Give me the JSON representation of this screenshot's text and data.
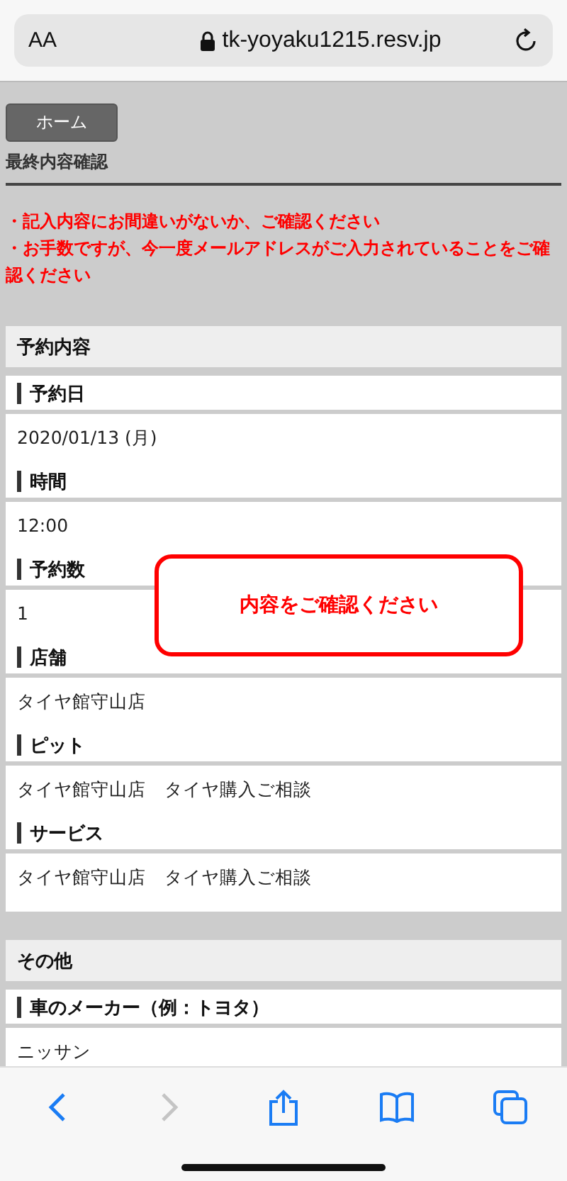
{
  "address_bar": {
    "text_size": "AA",
    "url": "tk-yoyaku1215.resv.jp"
  },
  "home_button": "ホーム",
  "page_title": "最終内容確認",
  "notices": [
    "・記入内容にお間違いがないか、ご確認ください",
    "・お手数ですが、今一度メールアドレスがご入力されていることをご確認ください"
  ],
  "sections": [
    {
      "title": "予約内容",
      "fields": [
        {
          "label": "予約日",
          "value": "2020/01/13 (月)"
        },
        {
          "label": "時間",
          "value": "12:00"
        },
        {
          "label": "予約数",
          "value": "1"
        },
        {
          "label": "店舗",
          "value": "タイヤ館守山店"
        },
        {
          "label": "ピット",
          "value": "タイヤ館守山店　タイヤ購入ご相談"
        },
        {
          "label": "サービス",
          "value": "タイヤ館守山店　タイヤ購入ご相談"
        }
      ]
    },
    {
      "title": "その他",
      "fields": [
        {
          "label": "車のメーカー（例：トヨタ）",
          "value": "ニッサン"
        }
      ]
    }
  ],
  "popup": {
    "message": "内容をご確認ください"
  },
  "toolbar": [
    {
      "kind": "back",
      "disabled": false
    },
    {
      "kind": "forward",
      "disabled": true
    },
    {
      "kind": "share",
      "disabled": false
    },
    {
      "kind": "bookmarks",
      "disabled": false
    },
    {
      "kind": "tabs",
      "disabled": false
    }
  ]
}
